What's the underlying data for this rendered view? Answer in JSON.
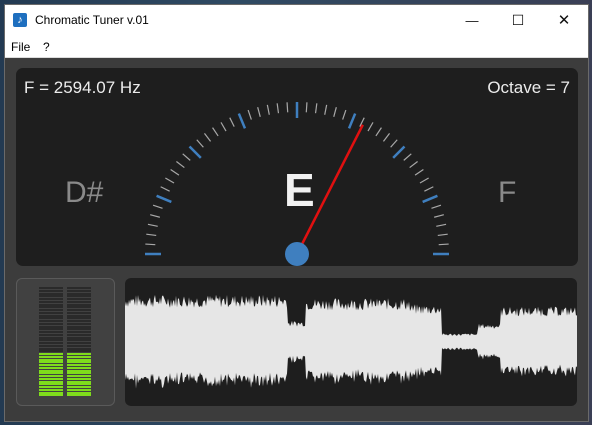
{
  "window": {
    "title": "Chromatic Tuner v.01",
    "minimize": "—",
    "maximize": "☐",
    "close": "✕"
  },
  "menu": {
    "file": "File",
    "help": "?"
  },
  "tuner": {
    "frequency_text": "F = 2594.07 Hz",
    "octave_text": "Octave = 7",
    "prev_note": "D#",
    "current_note": "E",
    "next_note": "F",
    "needle_offset_fraction": 0.3
  },
  "level_meter": {
    "segments": 40,
    "lit_segments": 16
  },
  "colors": {
    "panel": "#1e1e1e",
    "window_bg": "#3c3c3c",
    "tick_minor": "#a8a8a8",
    "tick_major": "#3f7fbf",
    "needle": "#e01010",
    "pivot": "#3f7fbf",
    "level_lit": "#7fdc1c",
    "level_off": "#2a2a2a",
    "waveform": "#e6e6e6"
  }
}
